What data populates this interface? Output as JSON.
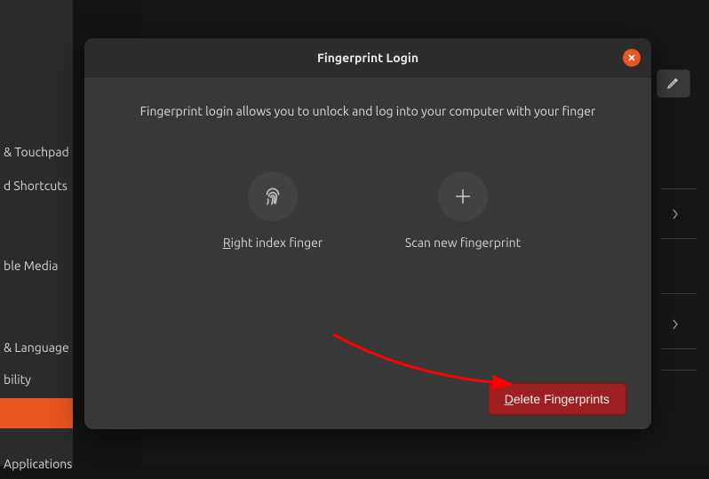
{
  "sidebar": {
    "items": [
      {
        "label": "& Touchpad"
      },
      {
        "label": "d Shortcuts"
      },
      {
        "label": "ble Media"
      },
      {
        "label": "& Language"
      },
      {
        "label": "bility"
      },
      {
        "label": ""
      },
      {
        "label": "Applications"
      }
    ]
  },
  "right": {
    "edit_icon": "pencil"
  },
  "dialog": {
    "title": "Fingerprint Login",
    "description": "Fingerprint login allows you to unlock and log into your computer with your finger",
    "options": {
      "existing": {
        "label": "Right index finger",
        "icon": "fingerprint"
      },
      "scan_new": {
        "label": "Scan new fingerprint",
        "icon": "plus"
      }
    },
    "delete_button": "Delete Fingerprints"
  },
  "colors": {
    "accent": "#e95420",
    "danger": "#9e1f1f"
  }
}
